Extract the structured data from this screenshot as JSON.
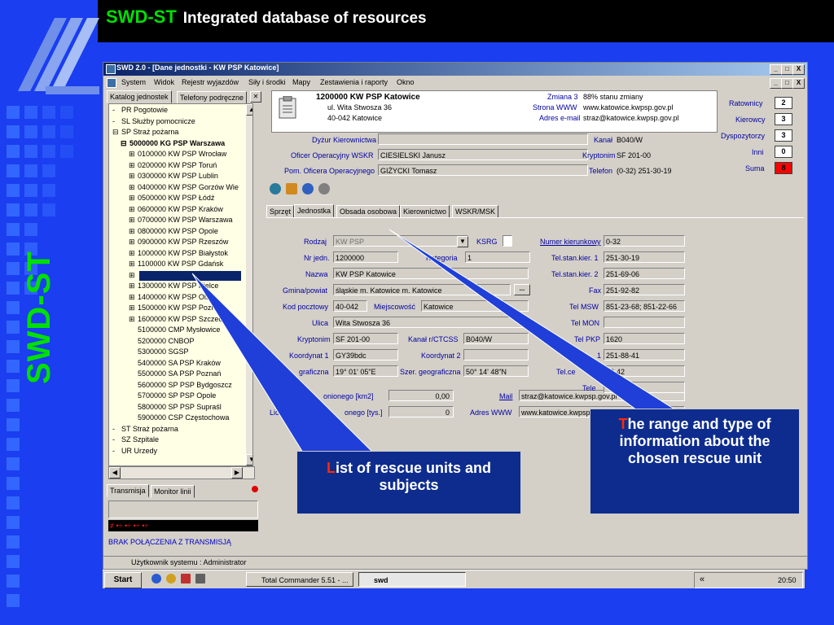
{
  "slide": {
    "title_main": "SWD-ST",
    "title_sub": "Integrated database of resources",
    "vertical_title": "SWD-ST",
    "logo_text": "SWD-ST"
  },
  "window": {
    "title": "SWD 2.0 - [Dane jednostki - KW PSP Katowice]",
    "controls": [
      "_",
      "□",
      "X"
    ],
    "menu": [
      "System",
      "Widok",
      "Rejestr wyjazdów",
      "Siły i środki",
      "Mapy",
      "Zestawienia i raporty",
      "Okno"
    ]
  },
  "left_panel": {
    "tabs": [
      "Katalog jednostek",
      "Telefony podręczne"
    ],
    "tree": [
      {
        "text": "PR Pogotowie",
        "level": 0,
        "exp": "-"
      },
      {
        "text": "SL Służby pomocnicze",
        "level": 0,
        "exp": "-"
      },
      {
        "text": "SP Straż pożarna",
        "level": 0,
        "exp": "⊟"
      },
      {
        "text": "5000000 KG PSP Warszawa",
        "level": 1,
        "exp": "⊟",
        "bold": true
      },
      {
        "text": "0100000 KW PSP Wrocław",
        "level": 2,
        "exp": "⊞"
      },
      {
        "text": "0200000 KW PSP Toruń",
        "level": 2,
        "exp": "⊞"
      },
      {
        "text": "0300000 KW PSP Lublin",
        "level": 2,
        "exp": "⊞"
      },
      {
        "text": "0400000 KW PSP Gorzów Wie",
        "level": 2,
        "exp": "⊞"
      },
      {
        "text": "0500000 KW PSP Łódź",
        "level": 2,
        "exp": "⊞"
      },
      {
        "text": "0600000 KW PSP Kraków",
        "level": 2,
        "exp": "⊞"
      },
      {
        "text": "0700000 KW PSP Warszawa",
        "level": 2,
        "exp": "⊞"
      },
      {
        "text": "0800000 KW PSP Opole",
        "level": 2,
        "exp": "⊞"
      },
      {
        "text": "0900000 KW PSP Rzeszów",
        "level": 2,
        "exp": "⊞"
      },
      {
        "text": "1000000 KW PSP Białystok",
        "level": 2,
        "exp": "⊞"
      },
      {
        "text": "1100000 KW PSP Gdańsk",
        "level": 2,
        "exp": "⊞"
      },
      {
        "text": "",
        "level": 2,
        "exp": "⊞",
        "selected": true
      },
      {
        "text": "1300000 KW PSP Kielce",
        "level": 2,
        "exp": "⊞"
      },
      {
        "text": "1400000 KW PSP Olszt",
        "level": 2,
        "exp": "⊞"
      },
      {
        "text": "1500000 KW PSP Pozna",
        "level": 2,
        "exp": "⊞"
      },
      {
        "text": "1600000 KW PSP Szczeci",
        "level": 2,
        "exp": "⊞"
      },
      {
        "text": "5100000 CMP Mysłowice",
        "level": 2,
        "exp": ""
      },
      {
        "text": "5200000 CNBOP",
        "level": 2,
        "exp": ""
      },
      {
        "text": "5300000 SGSP",
        "level": 2,
        "exp": ""
      },
      {
        "text": "5400000 SA PSP Kraków",
        "level": 2,
        "exp": ""
      },
      {
        "text": "5500000 SA PSP Poznań",
        "level": 2,
        "exp": ""
      },
      {
        "text": "5600000 SP PSP Bydgoszcz",
        "level": 2,
        "exp": ""
      },
      {
        "text": "5700000 SP PSP Opole",
        "level": 2,
        "exp": ""
      },
      {
        "text": "5800000 SP PSP Supraśl",
        "level": 2,
        "exp": ""
      },
      {
        "text": "5900000 CSP Częstochowa",
        "level": 2,
        "exp": ""
      },
      {
        "text": "ST Straż pożarna",
        "level": 0,
        "exp": "-"
      },
      {
        "text": "SZ Szpitale",
        "level": 0,
        "exp": "-"
      },
      {
        "text": "UR Urzedy",
        "level": 0,
        "exp": "-"
      }
    ],
    "trans_tabs": [
      "Transmisja",
      "Monitor linii"
    ],
    "trans_line": "≠ •÷ •÷ •÷ •÷",
    "trans_status": "BRAK POŁĄCZENIA Z TRANSMISJĄ"
  },
  "info": {
    "unit_name": "1200000 KW PSP Katowice",
    "address1": "ul. Wita Stwosza 36",
    "address2": "40-042 Katowice",
    "change_label": "Zmiana 3",
    "change_value": "88% stanu zmiany",
    "www_label": "Strona WWW",
    "www_value": "www.katowice.kwpsp.gov.pl",
    "email_label": "Adres e-mail",
    "email_value": "straz@katowice.kwpsp.gov.pl",
    "duty_label": "Dyżur Kierownictwa",
    "duty_value": "",
    "officer_label": "Oficer Operacyjny WSKR",
    "officer_value": "CIESIELSKI Janusz",
    "assist_label": "Pom. Oficera Operacyjnego",
    "assist_value": "GIŻYCKI Tomasz",
    "channel_label": "Kanał",
    "channel_value": "B040/W",
    "crypt_label": "Kryptonim",
    "crypt_value": "SF 201-00",
    "phone_label": "Telefon",
    "phone_value": "(0-32) 251-30-19"
  },
  "stats": [
    {
      "label": "Ratownicy",
      "value": "2"
    },
    {
      "label": "Kierowcy",
      "value": "3"
    },
    {
      "label": "Dyspozytorzy",
      "value": "3"
    },
    {
      "label": "Inni",
      "value": "0"
    },
    {
      "label": "Suma",
      "value": "8",
      "highlight": "#ff0000"
    }
  ],
  "detail_tabs": [
    "Sprzęt",
    "Jednostka",
    "Obsada osobowa",
    "Kierownictwo",
    "WSKR/MSK"
  ],
  "form": {
    "rodzaj_label": "Rodzaj",
    "rodzaj_value": "KW PSP",
    "ksrg_label": "KSRG",
    "nr_label": "Nr jedn.",
    "nr_value": "1200000",
    "kategoria_label": "Kategoria",
    "kategoria_value": "1",
    "nazwa_label": "Nazwa",
    "nazwa_value": "KW PSP Katowice",
    "gmina_label": "Gmina/powiat",
    "gmina_value": "śląskie m. Katowice m. Katowice",
    "kod_label": "Kod pocztowy",
    "kod_value": "40-042",
    "miejsc_label": "Miejscowość",
    "miejsc_value": "Katowice",
    "ulica_label": "Ulica",
    "ulica_value": "Wita Stwosza 36",
    "krypt_label": "Kryptonim",
    "krypt_value": "SF 201-00",
    "kanal_label": "Kanał r/CTCSS",
    "kanal_value": "B040/W",
    "koord1_label": "Koordynat 1",
    "koord1_value": "GY39bdc",
    "koord2_label": "Koordynat 2",
    "koord2_value": "",
    "geo1_label": "graficzna",
    "geo1_value": "19° 01' 05\"E",
    "geo2_label": "Szer. geograficzna",
    "geo2_value": "50° 14' 48\"N",
    "area_label": "onionego [km2]",
    "area_value": "0,00",
    "people_label": "Liczba m",
    "people_label2": "onego [tys.]",
    "people_value": "0",
    "mail_label": "Mail",
    "mail_value": "straz@katowice.kwpsp.gov.pl",
    "www_label": "Adres WWW",
    "www_value": "www.katowice.kwpsp",
    "numer_label": "Numer kierunkowy",
    "numer_value": "0-32",
    "tel1_label": "Tel.stan.kier. 1",
    "tel1_value": "251-30-19",
    "tel2_label": "Tel.stan.kier. 2",
    "tel2_value": "251-69-06",
    "fax_label": "Fax",
    "fax_value": "251-92-82",
    "msw_label": "Tel MSW",
    "msw_value": "851-23-68; 851-22-66",
    "mon_label": "Tel MON",
    "mon_value": "",
    "pkp_label": "Tel PKP",
    "pkp_value": "1620",
    "r1_label": "1",
    "r1_value": "251-88-41",
    "r2_label": "Tel.ce",
    "r2_value": "88-42",
    "r3_label": "Tele",
    "r3_value": ""
  },
  "statusbar": {
    "user": "Użytkownik systemu : Administrator"
  },
  "taskbar": {
    "start": "Start",
    "tasks": [
      "Total Commander 5.51 - ...",
      "swd"
    ],
    "tray_arrows": "«",
    "clock": "20:50"
  },
  "callouts": {
    "list_first": "L",
    "list_rest": "ist of rescue units and subjects",
    "range_first": "T",
    "range_rest": "he range and type of information about the chosen rescue unit"
  },
  "colors": {
    "slide_bg": "#1a3ef0",
    "title_green": "#00e000",
    "callout_bg": "#0d2c8e",
    "tree_bg": "#ffffe6"
  }
}
